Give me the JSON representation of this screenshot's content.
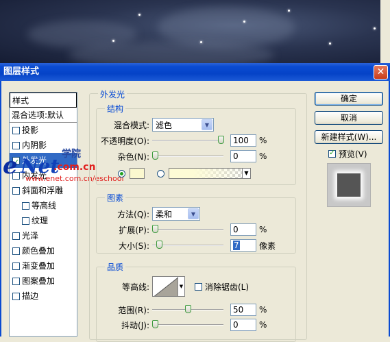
{
  "window": {
    "title": "图层样式",
    "close_symbol": "✕"
  },
  "styles_list": {
    "header": "样式",
    "blend_options": "混合选项:默认",
    "items": [
      {
        "label": "投影",
        "checked": false
      },
      {
        "label": "内阴影",
        "checked": false
      },
      {
        "label": "外发光",
        "checked": true,
        "selected": true
      },
      {
        "label": "内发光",
        "checked": false
      },
      {
        "label": "斜面和浮雕",
        "checked": false
      },
      {
        "label": "等高线",
        "checked": false,
        "indent": true
      },
      {
        "label": "纹理",
        "checked": false,
        "indent": true
      },
      {
        "label": "光泽",
        "checked": false
      },
      {
        "label": "颜色叠加",
        "checked": false
      },
      {
        "label": "渐变叠加",
        "checked": false
      },
      {
        "label": "图案叠加",
        "checked": false
      },
      {
        "label": "描边",
        "checked": false
      }
    ]
  },
  "watermark": {
    "e": "e",
    "net": "Net",
    "com": ".com.cn",
    "cn": "学院",
    "url": "www.enet.com.cn/eschool"
  },
  "outer_glow": {
    "title": "外发光",
    "structure": {
      "title": "结构",
      "blend_mode_label": "混合模式:",
      "blend_mode_value": "滤色",
      "opacity_label": "不透明度(O):",
      "opacity_value": "100",
      "opacity_unit": "%",
      "noise_label": "杂色(N):",
      "noise_value": "0",
      "noise_unit": "%",
      "glow_color": "#fbf8cf"
    },
    "elements": {
      "title": "图素",
      "technique_label": "方法(Q):",
      "technique_value": "柔和",
      "spread_label": "扩展(P):",
      "spread_value": "0",
      "spread_unit": "%",
      "size_label": "大小(S):",
      "size_value": "7",
      "size_unit": "像素"
    },
    "quality": {
      "title": "品质",
      "contour_label": "等高线:",
      "antialias_label": "消除锯齿(L)",
      "range_label": "范围(R):",
      "range_value": "50",
      "range_unit": "%",
      "jitter_label": "抖动(J):",
      "jitter_value": "0",
      "jitter_unit": "%"
    }
  },
  "buttons": {
    "ok": "确定",
    "cancel": "取消",
    "new_style": "新建样式(W)...",
    "preview": "预览(V)"
  }
}
